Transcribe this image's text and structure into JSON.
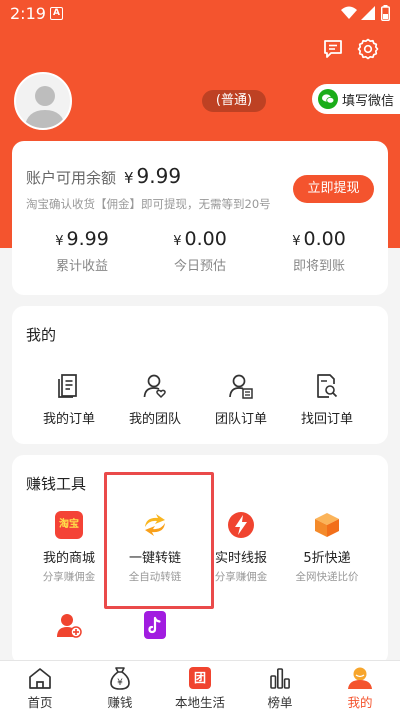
{
  "status_bar": {
    "time": "2:19",
    "notif_letter": "A"
  },
  "profile": {
    "level": "(普通)",
    "wechat_button": "填写微信"
  },
  "balance": {
    "title": "账户可用余额",
    "currency": "¥",
    "amount": "9.99",
    "note": "淘宝确认收货【佣金】即可提现，无需等到20号",
    "withdraw_button": "立即提现",
    "stats": [
      {
        "value": "9.99",
        "label": "累计收益"
      },
      {
        "value": "0.00",
        "label": "今日预估"
      },
      {
        "value": "0.00",
        "label": "即将到账"
      }
    ]
  },
  "mine": {
    "title": "我的",
    "items": [
      {
        "label": "我的订单",
        "icon": "order-list-icon"
      },
      {
        "label": "我的团队",
        "icon": "team-icon"
      },
      {
        "label": "团队订单",
        "icon": "team-order-icon"
      },
      {
        "label": "找回订单",
        "icon": "find-order-icon"
      }
    ]
  },
  "tools": {
    "title": "赚钱工具",
    "items": [
      {
        "label": "我的商城",
        "sub": "分享赚佣金",
        "icon": "taobao-icon",
        "icon_text": "淘宝"
      },
      {
        "label": "一键转链",
        "sub": "全自动转链",
        "icon": "convert-link-icon"
      },
      {
        "label": "实时线报",
        "sub": "分享赚佣金",
        "icon": "lightning-icon"
      },
      {
        "label": "5折快递",
        "sub": "全网快递比价",
        "icon": "package-icon"
      },
      {
        "label": "",
        "sub": "",
        "icon": "invite-user-icon"
      },
      {
        "label": "",
        "sub": "",
        "icon": "douyin-icon"
      }
    ]
  },
  "nav": {
    "items": [
      {
        "label": "首页",
        "icon": "home-icon"
      },
      {
        "label": "赚钱",
        "icon": "money-bag-icon"
      },
      {
        "label": "本地生活",
        "icon": "local-life-icon",
        "icon_text": "团"
      },
      {
        "label": "榜单",
        "icon": "ranking-icon"
      },
      {
        "label": "我的",
        "icon": "profile-icon"
      }
    ],
    "active": "我的"
  },
  "colors": {
    "accent": "#f4542e",
    "highlight_border": "#ea4a4a",
    "background": "#f4f4f4"
  }
}
